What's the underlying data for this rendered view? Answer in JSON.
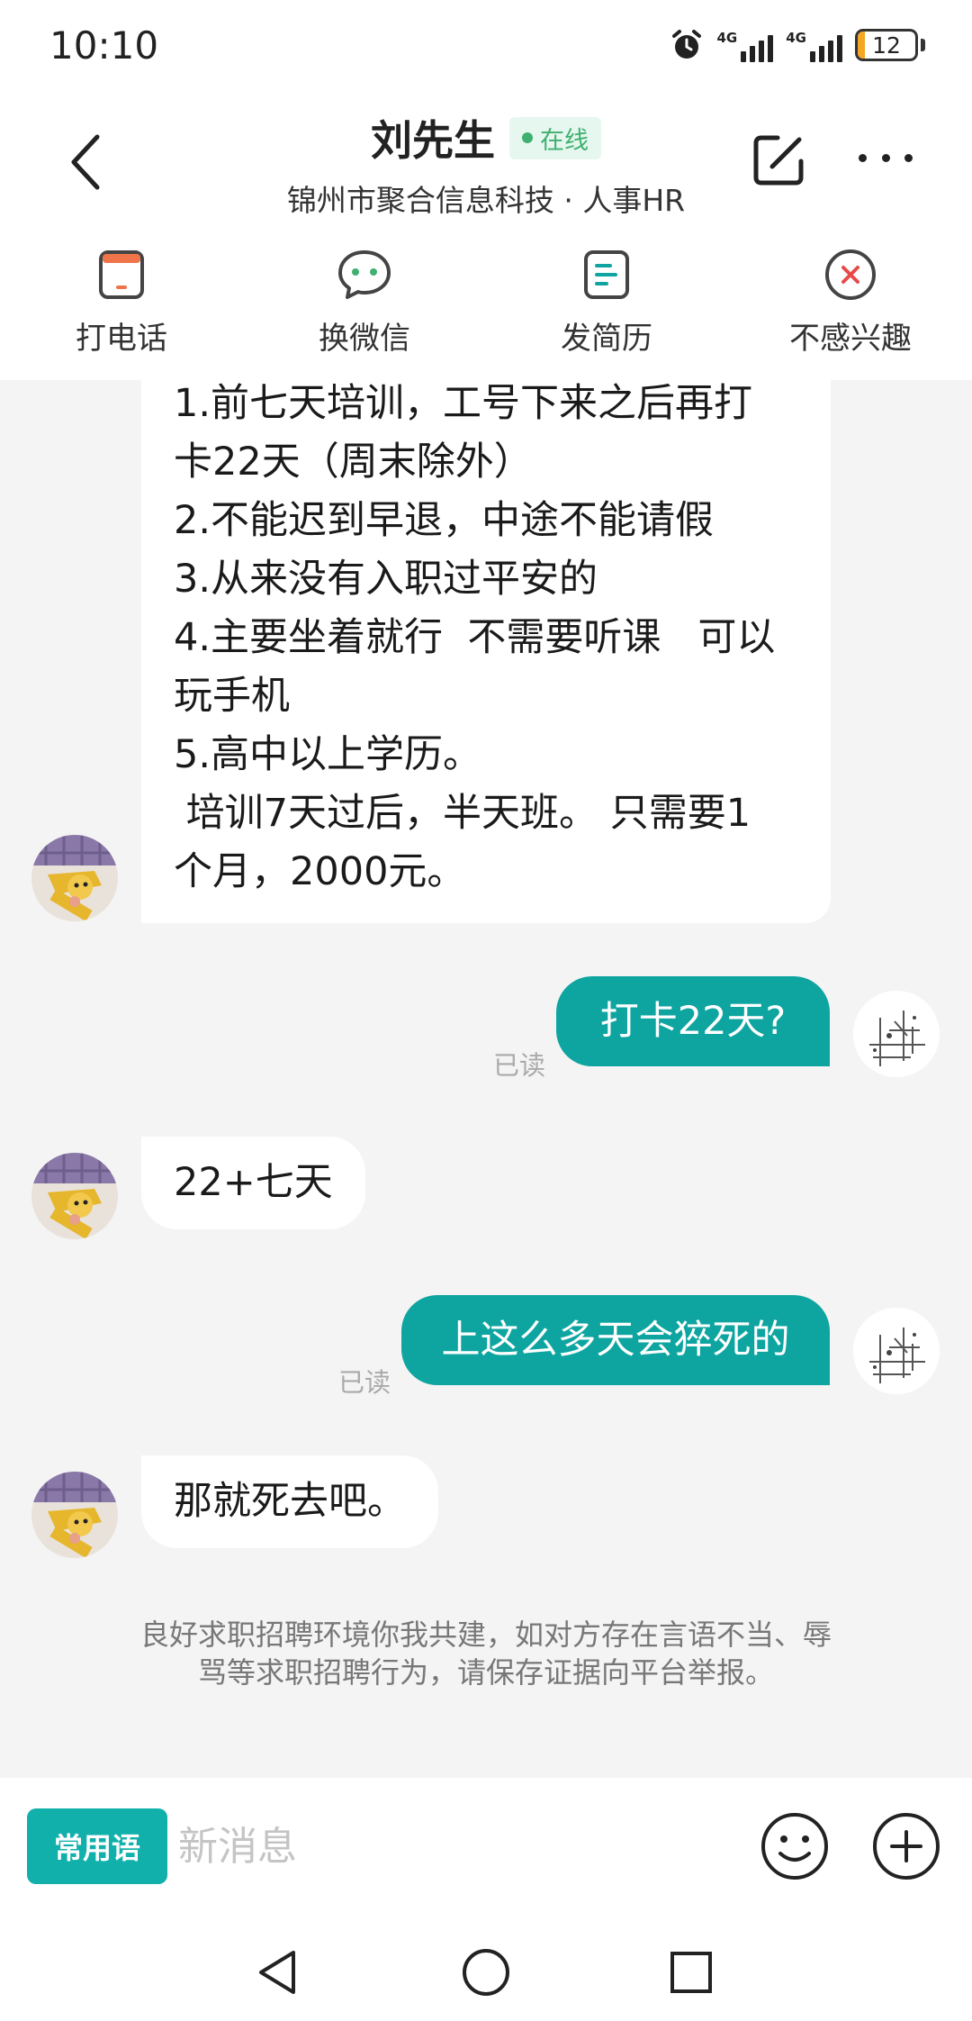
{
  "status_bar": {
    "time": "10:10",
    "network_1": "4G",
    "network_2": "4G",
    "battery": "12"
  },
  "header": {
    "contact_name": "刘先生",
    "online_status": "在线",
    "subtitle": "锦州市聚合信息科技 · 人事HR"
  },
  "actions": [
    {
      "label": "打电话",
      "icon": "phone-icon"
    },
    {
      "label": "换微信",
      "icon": "wechat-icon"
    },
    {
      "label": "发简历",
      "icon": "resume-icon"
    },
    {
      "label": "不感兴趣",
      "icon": "not-interested-icon"
    }
  ],
  "messages": [
    {
      "sender": "hr",
      "lines": [
        "1.前七天培训，工号下来之后再打",
        "卡22天（周末除外）",
        "2.不能迟到早退，中途不能请假",
        "3.从来没有入职过平安的",
        "4.主要坐着就行  不需要听课   可以",
        "玩手机",
        "5.高中以上学历。",
        " 培训7天过后，半天班。 只需要1",
        "个月，2000元。"
      ]
    },
    {
      "sender": "me",
      "text": "打卡22天?",
      "status": "已读"
    },
    {
      "sender": "hr",
      "text": "22+七天"
    },
    {
      "sender": "me",
      "text": "上这么多天会猝死的",
      "status": "已读"
    },
    {
      "sender": "hr",
      "text": "那就死去吧。"
    }
  ],
  "notice": "良好求职招聘环境你我共建，如对方存在言语不当、辱骂等求职招聘行为，请保存证据向平台举报。",
  "input_bar": {
    "phrase_button": "常用语",
    "placeholder": "新消息"
  },
  "colors": {
    "accent": "#0ea5a1",
    "online": "#3fb06f",
    "battery_low": "#f5a623",
    "danger": "#e84a4a"
  }
}
